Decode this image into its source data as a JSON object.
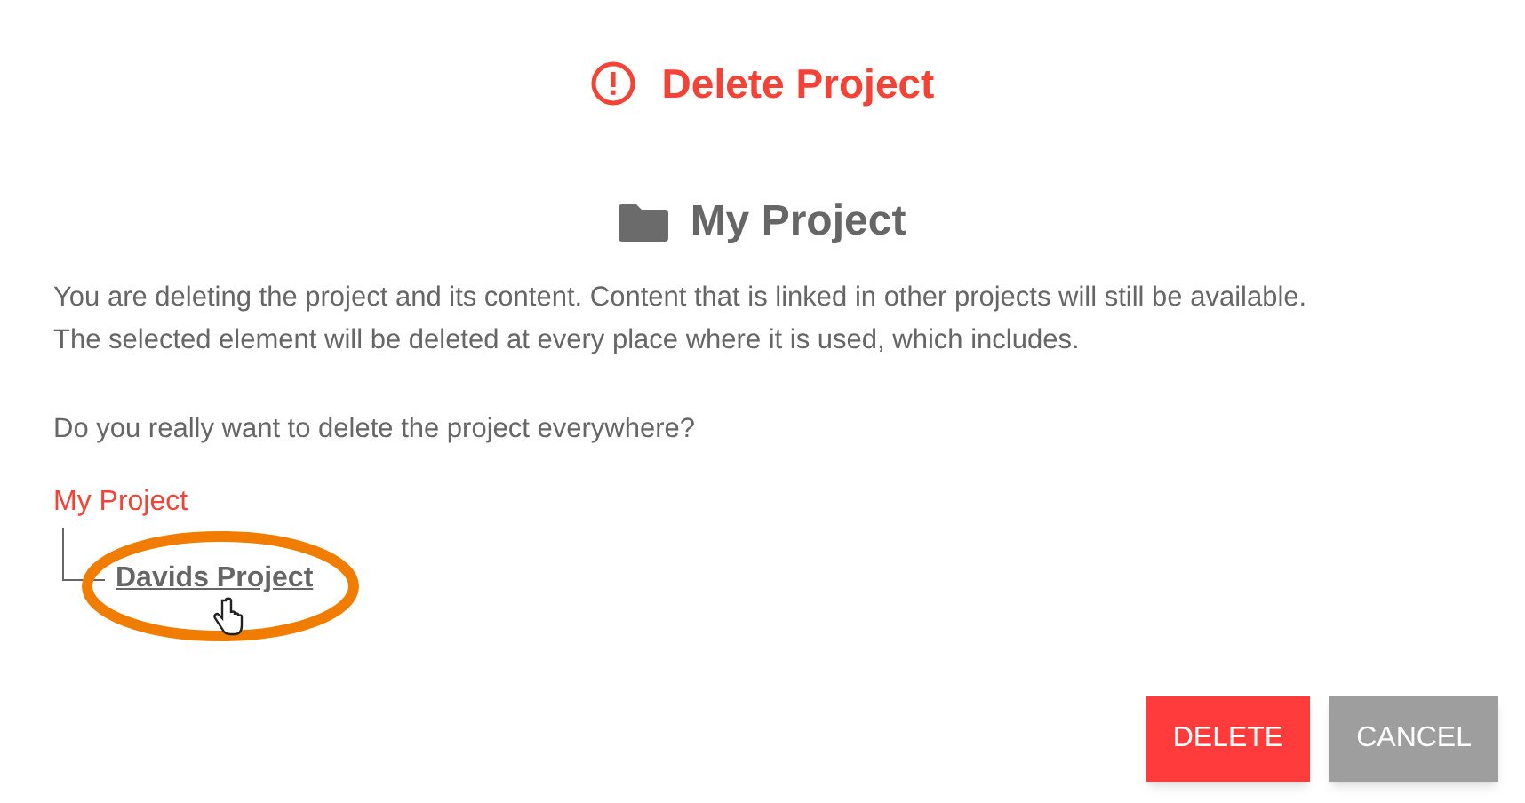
{
  "title": "Delete Project",
  "heading": "My Project",
  "paragraphs": [
    "You are deleting the project and its content. Content that is linked in other projects will still be available.",
    "The selected element will be deleted at every place where it is used, which includes."
  ],
  "question": "Do you really want to delete the project everywhere?",
  "tree": {
    "label": "My Project",
    "children": [
      {
        "label": "Davids Project",
        "highlighted": true
      }
    ]
  },
  "buttons": [
    {
      "label": "DELETE",
      "kind": "danger"
    },
    {
      "label": "CANCEL",
      "kind": "neutral"
    }
  ]
}
